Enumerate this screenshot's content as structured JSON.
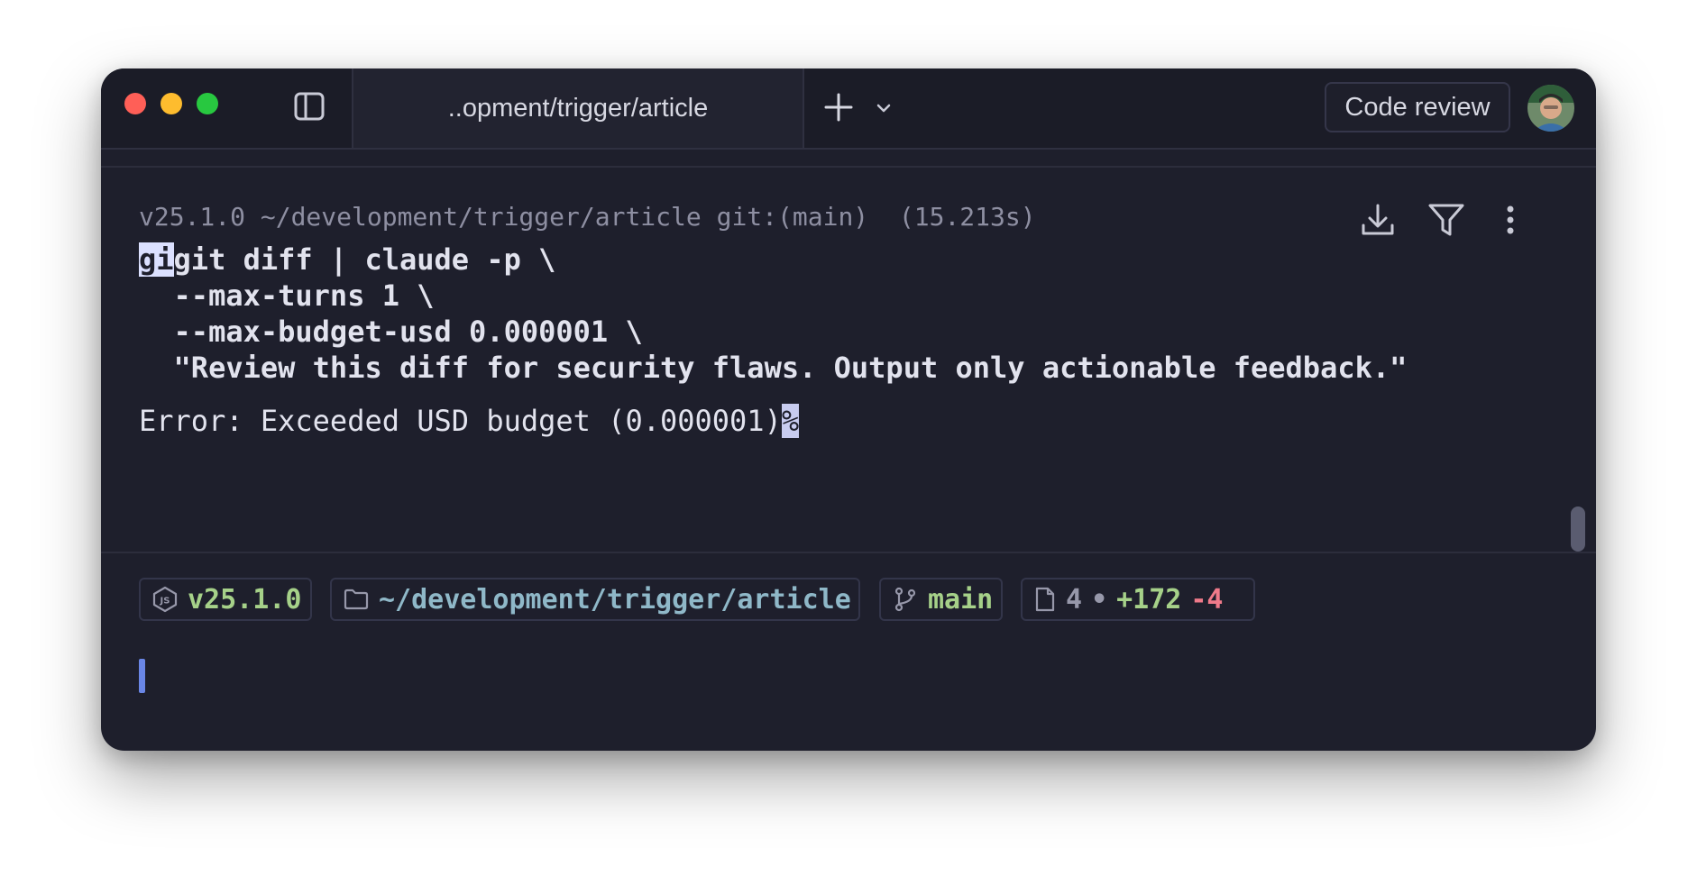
{
  "window": {
    "tab_title": "..opment/trigger/article",
    "code_review_label": "Code review"
  },
  "block": {
    "header": "v25.1.0 ~/development/trigger/article git:(main)  (15.213s)",
    "command_prefix_selected": "gi",
    "command_lines": [
      "git diff | claude -p \\",
      "  --max-turns 1 \\",
      "  --max-budget-usd 0.000001 \\",
      "  \"Review this diff for security flaws. Output only actionable feedback.\""
    ],
    "output": "Error: Exceeded USD budget (0.000001)",
    "output_end_mark": "%"
  },
  "prompt": {
    "node_version": "v25.1.0",
    "path": "~/development/trigger/article",
    "branch": "main",
    "files_changed": "4",
    "separator": "•",
    "additions": "+172",
    "deletions": "-4"
  },
  "icons": {
    "sidebar": "sidebar-toggle-icon",
    "new_tab": "plus-icon",
    "dropdown": "chevron-down-icon",
    "download": "download-icon",
    "filter": "filter-icon",
    "more": "more-vertical-icon",
    "node": "nodejs-icon",
    "folder": "folder-icon",
    "branch": "git-branch-icon",
    "file": "file-icon"
  },
  "colors": {
    "background": "#1e1f2c",
    "green": "#a6d189",
    "red": "#f07a8a",
    "path": "#8fb8c8",
    "cursor": "#6a86e6"
  }
}
